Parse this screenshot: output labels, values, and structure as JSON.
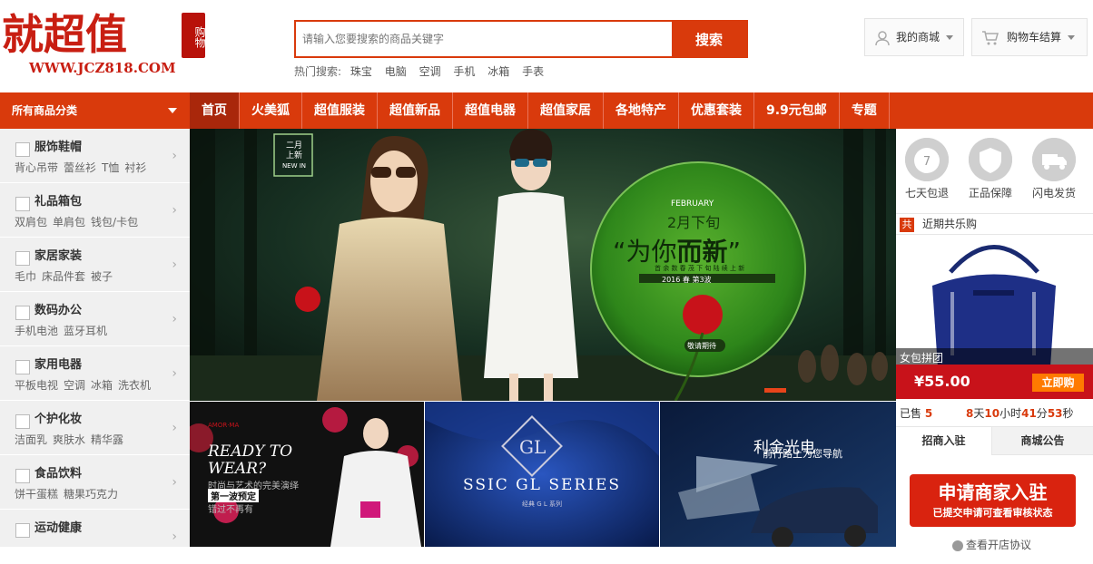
{
  "logo": {
    "main": "就超值",
    "seal": "购物",
    "url": "WWW.JCZ818.COM"
  },
  "search": {
    "placeholder": "请输入您要搜索的商品关键字",
    "button": "搜索",
    "hot_label": "热门搜索:",
    "hot_keywords": [
      "珠宝",
      "电脑",
      "空调",
      "手机",
      "冰箱",
      "手表"
    ]
  },
  "header": {
    "my_mall": "我的商城",
    "cart": "购物车结算"
  },
  "nav": {
    "all_categories": "所有商品分类",
    "items": [
      "首页",
      "火美狐",
      "超值服装",
      "超值新品",
      "超值电器",
      "超值家居",
      "各地特产",
      "优惠套装",
      "9.9元包邮",
      "专题"
    ]
  },
  "categories": [
    {
      "title": "服饰鞋帽",
      "subs": [
        "背心吊带",
        "蕾丝衫",
        "T恤",
        "衬衫"
      ]
    },
    {
      "title": "礼品箱包",
      "subs": [
        "双肩包",
        "单肩包",
        "钱包/卡包"
      ]
    },
    {
      "title": "家居家装",
      "subs": [
        "毛巾",
        "床品件套",
        "被子"
      ]
    },
    {
      "title": "数码办公",
      "subs": [
        "手机电池",
        "蓝牙耳机"
      ]
    },
    {
      "title": "家用电器",
      "subs": [
        "平板电视",
        "空调",
        "冰箱",
        "洗衣机"
      ]
    },
    {
      "title": "个护化妆",
      "subs": [
        "洁面乳",
        "爽肤水",
        "精华露"
      ]
    },
    {
      "title": "食品饮料",
      "subs": [
        "饼干蛋糕",
        "糖果巧克力"
      ]
    },
    {
      "title": "运动健康",
      "subs": []
    }
  ],
  "banner": {
    "tag_line1": "二月",
    "tag_line2": "上新",
    "tag_new": "NEW IN",
    "month": "FEBRUARY",
    "period": "2月下旬",
    "headline_pre": "“为你",
    "headline_bold": "而新",
    "headline_post": "”",
    "sub": "首 余 数 春 茂 下 旬 陆 续 上 新",
    "season": "2016 春 第3波",
    "cta": "敬请期待"
  },
  "tiles": {
    "t1": {
      "brand": "AMOR·MA",
      "line1": "READY TO",
      "line2": "WEAR?",
      "desc": "时尚与艺术的完美演绎",
      "badge": "第一波预定",
      "more": "错过不再有"
    },
    "t2": {
      "logo": "GL",
      "series": "SSIC GL SERIES",
      "sub": "经典 G L 系列"
    },
    "t3": {
      "title": "利金光电",
      "sub": "前行路上为您导航"
    }
  },
  "services": [
    "七天包退",
    "正品保障",
    "闪电发货"
  ],
  "group_buy": {
    "icon": "共",
    "title": "近期共乐购",
    "product": "女包拼团",
    "price": "¥55.00",
    "buy": "立即购",
    "sold_label": "已售",
    "sold": "5",
    "days": "8",
    "hours": "10",
    "mins": "41",
    "secs": "53",
    "u_day": "天",
    "u_hour": "小时",
    "u_min": "分",
    "u_sec": "秒"
  },
  "tabs": [
    "招商入驻",
    "商城公告"
  ],
  "merchant": {
    "title": "申请商家入驻",
    "sub": "已提交申请可查看审核状态",
    "link": "查看开店协议"
  }
}
